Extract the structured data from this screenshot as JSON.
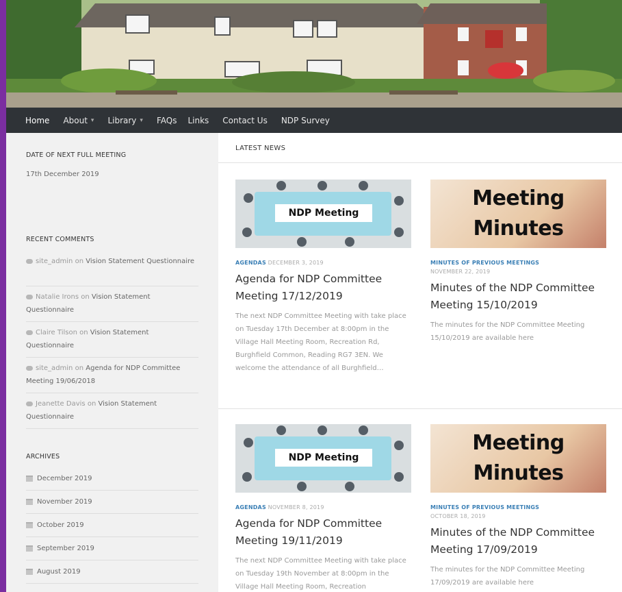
{
  "nav": {
    "items": [
      {
        "label": "Home",
        "dropdown": false
      },
      {
        "label": "About",
        "dropdown": true
      },
      {
        "label": "Library",
        "dropdown": true
      },
      {
        "label": "FAQs",
        "dropdown": false
      },
      {
        "label": "Links",
        "dropdown": false
      },
      {
        "label": "Contact Us",
        "dropdown": false
      },
      {
        "label": "NDP Survey",
        "dropdown": false
      }
    ],
    "caret": "▾"
  },
  "sidebar": {
    "meeting": {
      "title": "DATE OF NEXT FULL MEETING",
      "date": "17th December 2019"
    },
    "recent_comments": {
      "title": "RECENT COMMENTS",
      "items": [
        {
          "author": "site_admin",
          "on": "on",
          "post": "Vision Statement Questionnaire"
        },
        {
          "author": "Natalie Irons",
          "on": "on",
          "post": "Vision Statement Questionnaire"
        },
        {
          "author": "Claire Tilson",
          "on": "on",
          "post": "Vision Statement Questionnaire"
        },
        {
          "author": "site_admin",
          "on": "on",
          "post": "Agenda for NDP Committee Meeting 19/06/2018"
        },
        {
          "author": "Jeanette Davis",
          "on": "on",
          "post": "Vision Statement Questionnaire"
        }
      ]
    },
    "archives": {
      "title": "ARCHIVES",
      "items": [
        "December 2019",
        "November 2019",
        "October 2019",
        "September 2019",
        "August 2019"
      ]
    }
  },
  "main": {
    "section_title": "LATEST NEWS",
    "posts": [
      {
        "category": "AGENDAS",
        "date": "DECEMBER 3, 2019",
        "title": "Agenda for NDP Committee Meeting 17/12/2019",
        "excerpt": "The next NDP Committee Meeting with take place on Tuesday 17th December at 8:00pm in the Village Hall Meeting Room, Recreation Rd, Burghfield Common, Reading RG7 3EN. We welcome the attendance of all Burghfield…",
        "image_text": "NDP Meeting"
      },
      {
        "category": "MINUTES OF PREVIOUS MEETINGS",
        "date": "NOVEMBER 22, 2019",
        "title": "Minutes of the NDP Committee Meeting 15/10/2019",
        "excerpt": "The minutes for the NDP Committee Meeting 15/10/2019 are available here",
        "image_text_1": "Meeting",
        "image_text_2": "Minutes"
      },
      {
        "category": "AGENDAS",
        "date": "NOVEMBER 8, 2019",
        "title": "Agenda for NDP Committee Meeting 19/11/2019",
        "excerpt": "The next NDP Committee Meeting with take place on Tuesday 19th November at 8:00pm in the Village Hall Meeting Room, Recreation",
        "image_text": "NDP Meeting"
      },
      {
        "category": "MINUTES OF PREVIOUS MEETINGS",
        "date": "OCTOBER 18, 2019",
        "title": "Minutes of the NDP Committee Meeting 17/09/2019",
        "excerpt": "The minutes for the NDP Committee Meeting 17/09/2019 are available here",
        "image_text_1": "Meeting",
        "image_text_2": "Minutes"
      }
    ]
  },
  "colors": {
    "accent": "#7b2ea0",
    "nav_bg": "#2f3337",
    "category": "#3a7fb5"
  }
}
